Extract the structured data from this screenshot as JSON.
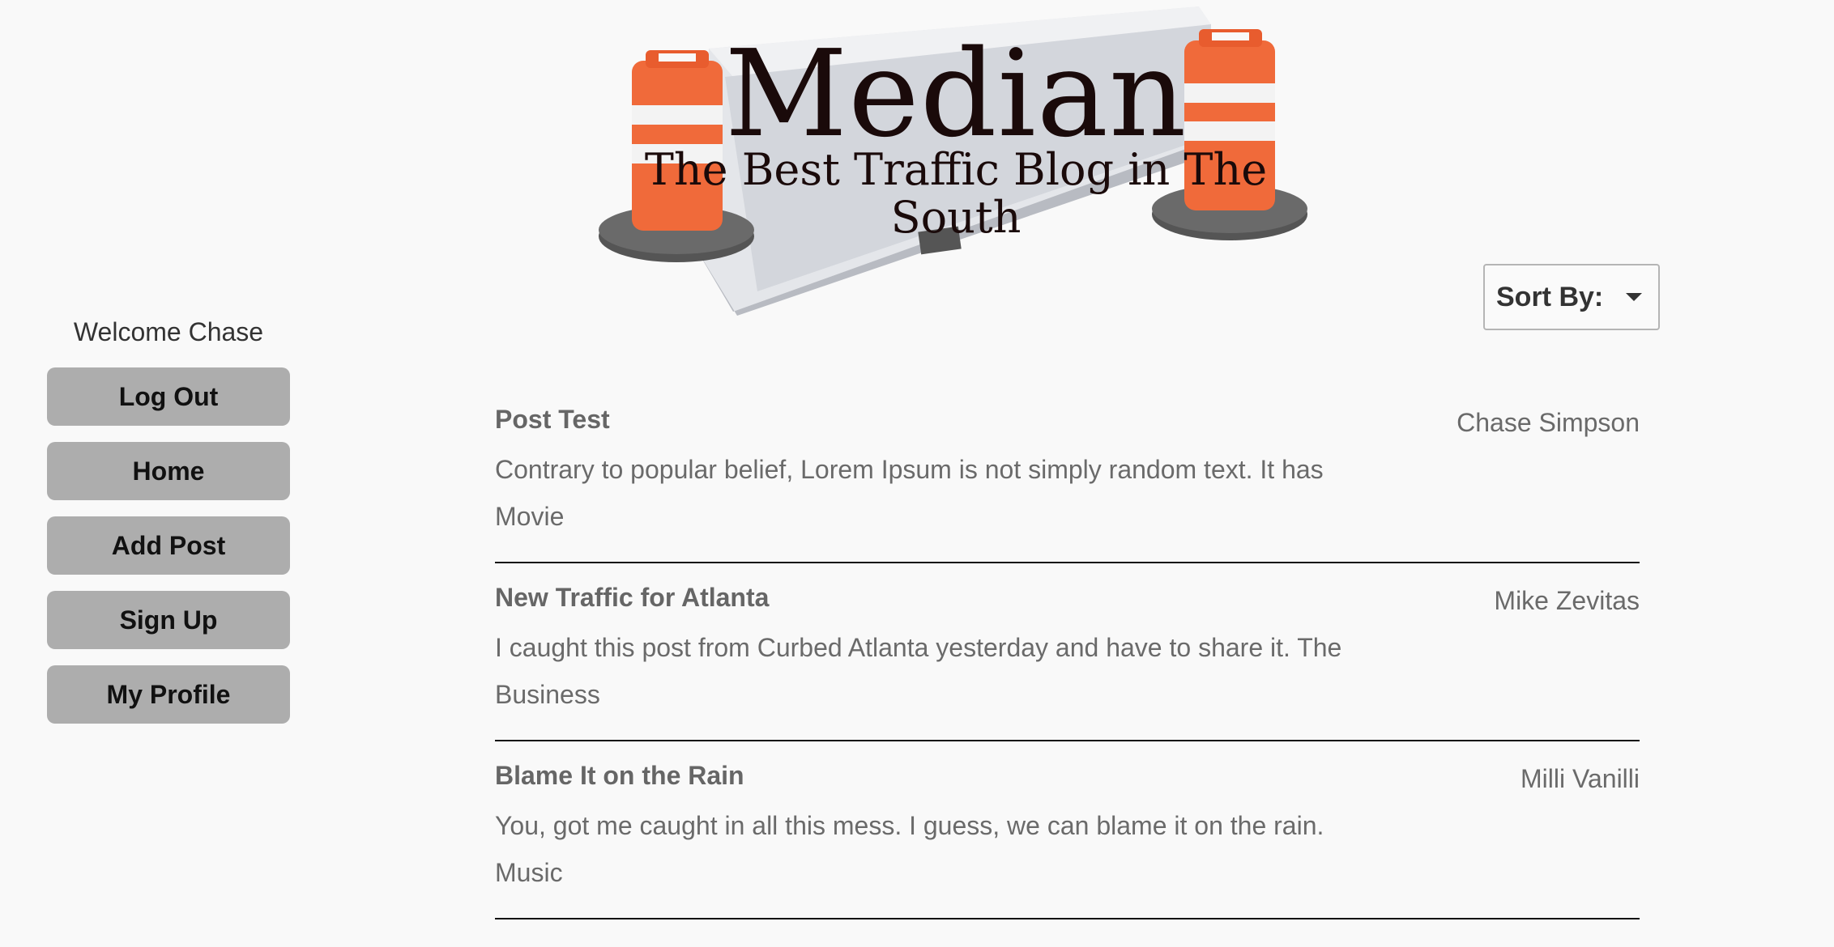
{
  "header": {
    "title": "Median",
    "tagline": "The Best Traffic Blog in The South"
  },
  "sidebar": {
    "welcome": "Welcome Chase",
    "buttons": [
      {
        "label": "Log Out"
      },
      {
        "label": "Home"
      },
      {
        "label": "Add Post"
      },
      {
        "label": "Sign Up"
      },
      {
        "label": "My Profile"
      }
    ]
  },
  "sort": {
    "label": "Sort By:"
  },
  "posts": [
    {
      "title": "Post Test",
      "author": "Chase Simpson",
      "excerpt": "Contrary to popular belief, Lorem Ipsum is not simply random text. It has",
      "category": "Movie"
    },
    {
      "title": "New Traffic for Atlanta",
      "author": "Mike Zevitas",
      "excerpt": "I caught this post from Curbed Atlanta yesterday and have to share it. The",
      "category": "Business"
    },
    {
      "title": "Blame It on the Rain",
      "author": "Milli Vanilli",
      "excerpt": "You, got me caught in all this mess. I guess, we can blame it on the rain.",
      "category": "Music"
    }
  ],
  "colors": {
    "background": "#f9f9f9",
    "button": "#adadad",
    "cone_orange": "#f06a3a",
    "barrier": "#d9dbe0"
  },
  "icons": [
    "traffic-barrel-icon",
    "concrete-barrier-icon",
    "chevron-down-icon"
  ]
}
